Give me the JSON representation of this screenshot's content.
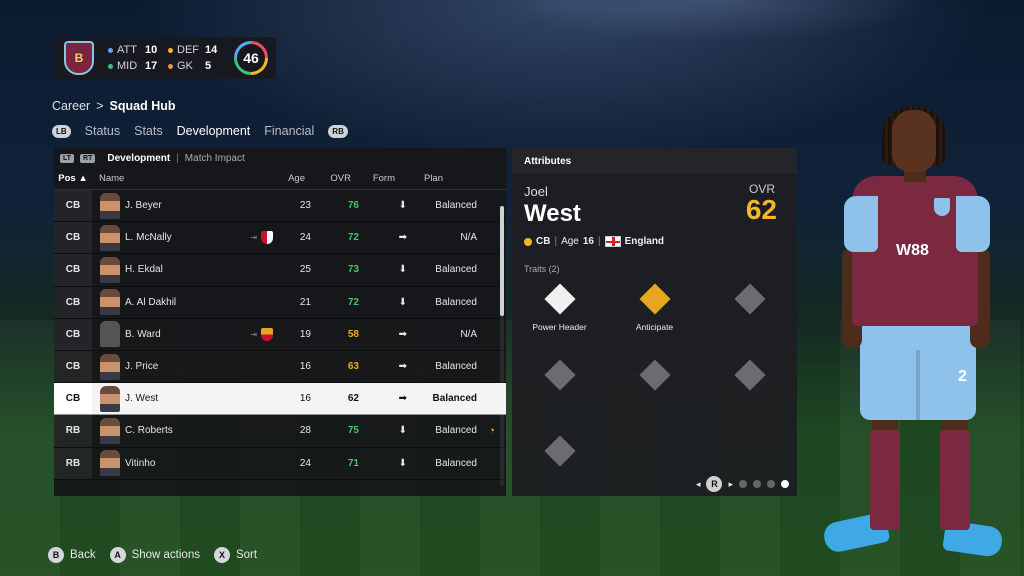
{
  "club": {
    "crest_text": "B",
    "ratings": [
      {
        "label": "ATT",
        "value": "10",
        "color": "#5aa6ff"
      },
      {
        "label": "DEF",
        "value": "14",
        "color": "#f5b72a"
      },
      {
        "label": "MID",
        "value": "17",
        "color": "#3fbf7f"
      },
      {
        "label": "GK",
        "value": "5",
        "color": "#e9944e"
      }
    ],
    "ovr": "46"
  },
  "breadcrumb": {
    "root": "Career",
    "sep": ">",
    "current": "Squad Hub"
  },
  "tabs": {
    "left_pill": "LB",
    "right_pill": "RB",
    "items": [
      "Status",
      "Stats",
      "Development",
      "Financial"
    ],
    "active": "Development"
  },
  "subhead": {
    "left_trigger": "LT",
    "right_trigger": "RT",
    "selected": "Development",
    "separator": "|",
    "other": "Match Impact"
  },
  "columns": {
    "pos": "Pos ▲",
    "name": "Name",
    "age": "Age",
    "ovr": "OVR",
    "form": "Form",
    "plan": "Plan"
  },
  "rows": [
    {
      "pos": "CB",
      "name": "J. Beyer",
      "age": "23",
      "ovr": "76",
      "form": "⬇",
      "plan": "Balanced",
      "ovr_color": "green"
    },
    {
      "pos": "CB",
      "name": "L. McNally",
      "age": "24",
      "ovr": "72",
      "form": "➡",
      "plan": "N/A",
      "ovr_color": "green",
      "loan": "⇥"
    },
    {
      "pos": "CB",
      "name": "H. Ekdal",
      "age": "25",
      "ovr": "73",
      "form": "⬇",
      "plan": "Balanced",
      "ovr_color": "green"
    },
    {
      "pos": "CB",
      "name": "A. Al Dakhil",
      "age": "21",
      "ovr": "72",
      "form": "⬇",
      "plan": "Balanced",
      "ovr_color": "green"
    },
    {
      "pos": "CB",
      "name": "B. Ward",
      "age": "19",
      "ovr": "58",
      "form": "➡",
      "plan": "N/A",
      "ovr_color": "orange",
      "loan": "⇥"
    },
    {
      "pos": "CB",
      "name": "J. Price",
      "age": "16",
      "ovr": "63",
      "form": "➡",
      "plan": "Balanced",
      "ovr_color": "orange"
    },
    {
      "pos": "CB",
      "name": "J. West",
      "age": "16",
      "ovr": "62",
      "form": "➡",
      "plan": "Balanced",
      "ovr_color": "orange"
    },
    {
      "pos": "RB",
      "name": "C. Roberts",
      "age": "28",
      "ovr": "75",
      "form": "⬇",
      "plan": "Balanced",
      "ovr_color": "green",
      "extra": "◔"
    },
    {
      "pos": "RB",
      "name": "Vitinho",
      "age": "24",
      "ovr": "71",
      "form": "⬇",
      "plan": "Balanced",
      "ovr_color": "green"
    }
  ],
  "attributes": {
    "title": "Attributes",
    "first_name": "Joel",
    "last_name": "West",
    "ovr_label": "OVR",
    "ovr": "62",
    "position": "CB",
    "age_text": "Age",
    "age": "16",
    "nation": "England",
    "traits_label": "Traits (2)",
    "traits": [
      {
        "name": "Power Header",
        "style": "white",
        "icon": "power-header-icon"
      },
      {
        "name": "Anticipate",
        "style": "gold",
        "icon": "anticipate-icon"
      },
      {
        "name": "",
        "style": "empty"
      },
      {
        "name": "",
        "style": "empty"
      },
      {
        "name": "",
        "style": "empty"
      },
      {
        "name": "",
        "style": "empty"
      },
      {
        "name": "",
        "style": "empty"
      }
    ],
    "pager_button": "R"
  },
  "player_figure": {
    "sponsor": "W88",
    "number": "2"
  },
  "footer": [
    {
      "key": "B",
      "label": "Back"
    },
    {
      "key": "A",
      "label": "Show actions"
    },
    {
      "key": "X",
      "label": "Sort"
    }
  ]
}
